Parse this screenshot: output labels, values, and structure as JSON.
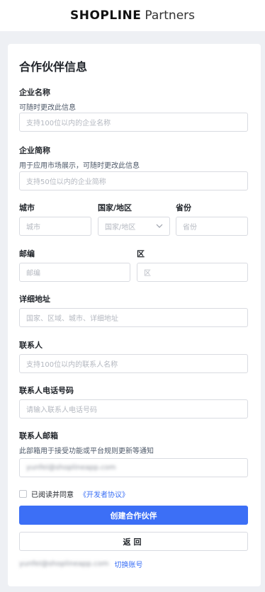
{
  "header": {
    "logo_brand": "SHOPLINE",
    "logo_suffix": "Partners"
  },
  "form": {
    "title": "合作伙伴信息",
    "company_name": {
      "label": "企业名称",
      "hint": "可随时更改此信息",
      "placeholder": "支持100位以内的企业名称"
    },
    "company_short": {
      "label": "企业简称",
      "hint": "用于应用市场展示，可随时更改此信息",
      "placeholder": "支持50位以内的企业简称"
    },
    "city": {
      "label": "城市",
      "placeholder": "城市"
    },
    "country": {
      "label": "国家/地区",
      "placeholder": "国家/地区"
    },
    "province": {
      "label": "省份",
      "placeholder": "省份"
    },
    "postcode": {
      "label": "邮编",
      "placeholder": "邮编"
    },
    "district": {
      "label": "区",
      "placeholder": "区"
    },
    "address": {
      "label": "详细地址",
      "placeholder": "国家、区域、城市、详细地址"
    },
    "contact": {
      "label": "联系人",
      "placeholder": "支持100位以内的联系人名称"
    },
    "phone": {
      "label": "联系人电话号码",
      "placeholder": "请输入联系人电话号码"
    },
    "email": {
      "label": "联系人邮箱",
      "hint": "此部箱用于接受功能或平台规则更新等通知",
      "value": "yunfei@shoplineapp.com"
    },
    "agreement": {
      "text": "已阅读并同意",
      "link": "《开发者协议》"
    },
    "submit_label": "创建合作伙伴",
    "back_label": "返回"
  },
  "footer": {
    "account_email": "yunfei@shoplineapp.com",
    "switch_label": "切换账号"
  }
}
